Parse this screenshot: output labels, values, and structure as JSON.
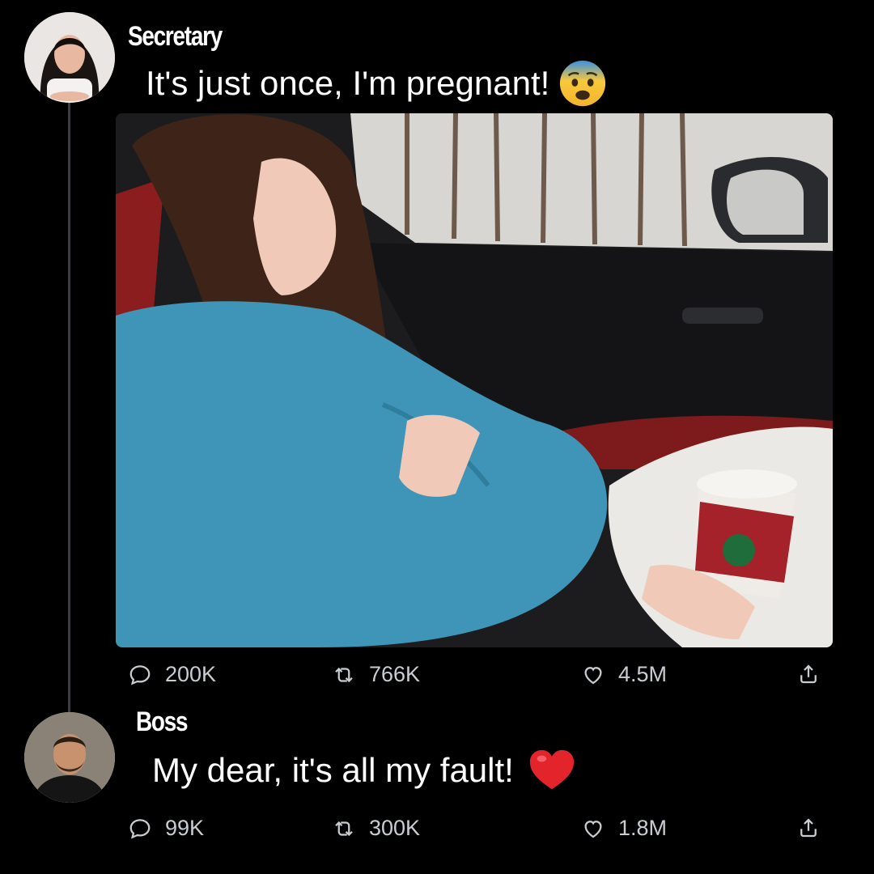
{
  "posts": [
    {
      "author": "Secretary",
      "text": "It's just once, I'm pregnant!",
      "emoji": "fearful-face-emoji",
      "media": "photo-pregnant-woman-in-car",
      "stats": {
        "replies": "200K",
        "reposts": "766K",
        "likes": "4.5M"
      }
    },
    {
      "author": "Boss",
      "text": "My dear, it's all my fault!",
      "emoji": "red-heart-emoji",
      "stats": {
        "replies": "99K",
        "reposts": "300K",
        "likes": "1.8M"
      }
    }
  ],
  "icons": {
    "reply": "reply-icon",
    "repost": "repost-icon",
    "like": "heart-icon",
    "share": "share-icon"
  },
  "colors": {
    "background": "#000000",
    "text": "#ffffff",
    "stat_text": "#c9cdd1",
    "thread_line": "#3a3d41"
  }
}
